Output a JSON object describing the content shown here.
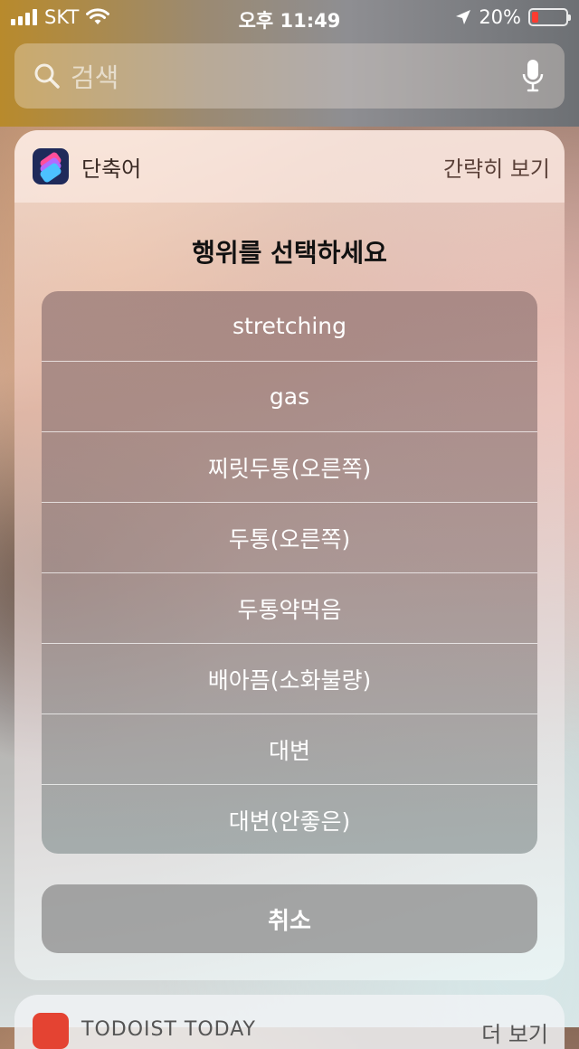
{
  "status_bar": {
    "carrier": "SKT",
    "time": "오후 11:49",
    "battery_percent": "20%",
    "battery_level": 0.2
  },
  "search": {
    "placeholder": "검색"
  },
  "widget": {
    "app_name": "단축어",
    "collapse_label": "간략히 보기",
    "prompt": "행위를 선택하세요",
    "options": [
      "stretching",
      "gas",
      "찌릿두통(오른쪽)",
      "두통(오른쪽)",
      "두통약먹음",
      "배아픔(소화불량)",
      "대변",
      "대변(안좋은)"
    ],
    "cancel_label": "취소"
  },
  "next_widget": {
    "title": "TODOIST TODAY",
    "more_label": "더 보기"
  },
  "colors": {
    "battery_low": "#ff3b30",
    "shortcuts_icon_bg": "#1f2a5a",
    "todoist_red": "#e44332"
  }
}
